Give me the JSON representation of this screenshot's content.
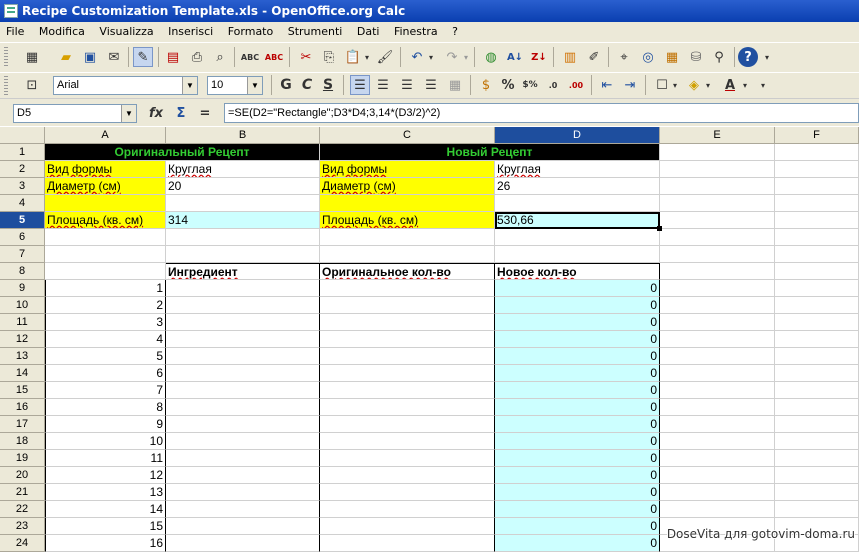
{
  "window": {
    "title": "Recipe Customization Template.xls - OpenOffice.org Calc"
  },
  "menu": [
    "File",
    "Modifica",
    "Visualizza",
    "Inserisci",
    "Formato",
    "Strumenti",
    "Dati",
    "Finestra",
    "?"
  ],
  "format_toolbar": {
    "font_name": "Arial",
    "font_size": "10",
    "bold_label": "G",
    "italic_label": "C",
    "underline_label": "S"
  },
  "formula_bar": {
    "cell_ref": "D5",
    "formula": "=SE(D2=\"Rectangle\";D3*D4;3,14*(D3/2)^2)"
  },
  "columns": [
    "A",
    "B",
    "C",
    "D",
    "E",
    "F"
  ],
  "sheet": {
    "original_header": "Оригинальный Рецепт",
    "new_header": "Новый Рецепт",
    "shape_label": "Вид формы",
    "shape_original": "Круглая",
    "shape_new": "Круглая",
    "diameter_label": "Диаметр (см)",
    "diameter_original": "20",
    "diameter_new": "26",
    "area_label": "Площадь (кв. см)",
    "area_original": "314",
    "area_new": "530,66",
    "ingredient_header": "Ингредиент",
    "original_qty_header": "Оригинальное кол-во",
    "new_qty_header": "Новое кол-во",
    "ingredient_rows": [
      {
        "row": "9",
        "n": "1",
        "new_qty": "0"
      },
      {
        "row": "10",
        "n": "2",
        "new_qty": "0"
      },
      {
        "row": "11",
        "n": "3",
        "new_qty": "0"
      },
      {
        "row": "12",
        "n": "4",
        "new_qty": "0"
      },
      {
        "row": "13",
        "n": "5",
        "new_qty": "0"
      },
      {
        "row": "14",
        "n": "6",
        "new_qty": "0"
      },
      {
        "row": "15",
        "n": "7",
        "new_qty": "0"
      },
      {
        "row": "16",
        "n": "8",
        "new_qty": "0"
      },
      {
        "row": "17",
        "n": "9",
        "new_qty": "0"
      },
      {
        "row": "18",
        "n": "10",
        "new_qty": "0"
      },
      {
        "row": "19",
        "n": "11",
        "new_qty": "0"
      },
      {
        "row": "20",
        "n": "12",
        "new_qty": "0"
      },
      {
        "row": "21",
        "n": "13",
        "new_qty": "0"
      },
      {
        "row": "22",
        "n": "14",
        "new_qty": "0"
      },
      {
        "row": "23",
        "n": "15",
        "new_qty": "0"
      },
      {
        "row": "24",
        "n": "16",
        "new_qty": "0"
      }
    ]
  },
  "watermark": "DoseVita для gotovim-doma.ru"
}
